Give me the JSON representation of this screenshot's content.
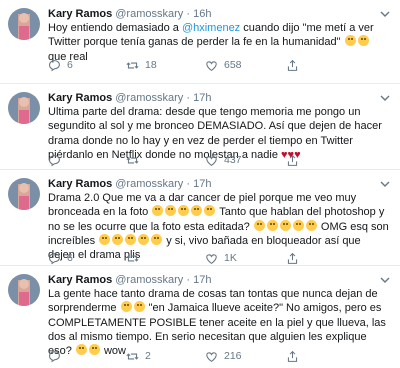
{
  "colors": {
    "link": "#1b95e0",
    "secondary": "#657786",
    "heart": "#c0112f",
    "border": "#e6ecf0"
  },
  "tweets": [
    {
      "name": "Kary Ramos",
      "handle": "@ramosskary",
      "dot": "·",
      "time": "16h",
      "text_parts": {
        "before": "Hoy entiendo demasiado a ",
        "mention": "@hximenez",
        "after": " cuando dijo \"me metí a ver Twitter porque tenía ganas de perder la fe en la humanidad\" ",
        "emojis": [
          "grin-sweat",
          "grin-sweat"
        ],
        "end": " que real"
      },
      "replies": "6",
      "retweets": "18",
      "likes": "658"
    },
    {
      "name": "Kary Ramos",
      "handle": "@ramosskary",
      "dot": "·",
      "time": "17h",
      "text": "Ultima parte del drama: desde que tengo memoria me pongo un segundito al sol y me bronceo DEMASIADO. Así que dejen de hacer drama donde no lo hay y en vez de perder el tiempo en Twitter piérdanlo en Netflix donde no molestan a nadie ",
      "hearts": [
        "♥",
        "♥",
        "♥"
      ],
      "replies": "",
      "retweets": "",
      "likes": "437"
    },
    {
      "name": "Kary Ramos",
      "handle": "@ramosskary",
      "dot": "·",
      "time": "17h",
      "text_parts": {
        "a": "Drama 2.0 Que me va a dar cancer de piel porque me veo muy bronceada en la foto ",
        "b": " Tanto que hablan del photoshop y no se les ocurre que la foto esta editada? ",
        "c": " OMG esq son increíbles ",
        "d": " y si, vivo bañada en bloqueador así que dejen el drama plis"
      },
      "replies": "6",
      "retweets": "",
      "likes": "1K"
    },
    {
      "name": "Kary Ramos",
      "handle": "@ramosskary",
      "dot": "·",
      "time": "17h",
      "text_parts": {
        "a": "La gente hace tanto drama de cosas tan tontas que nunca dejan de sorprenderme ",
        "b": " \"en Jamaica llueve aceite?\" No amigos, pero es COMPLETAMENTE POSIBLE tener aceite en la piel y que llueva, las dos al mismo tiempo. En serio necesitan que alguien les explique eso? ",
        "c": " wow"
      },
      "replies": "",
      "retweets": "2",
      "likes": "216"
    }
  ],
  "icons": {
    "reply": "reply-icon",
    "retweet": "retweet-icon",
    "like": "heart-icon",
    "share": "share-icon",
    "menu": "chevron-down-icon"
  }
}
